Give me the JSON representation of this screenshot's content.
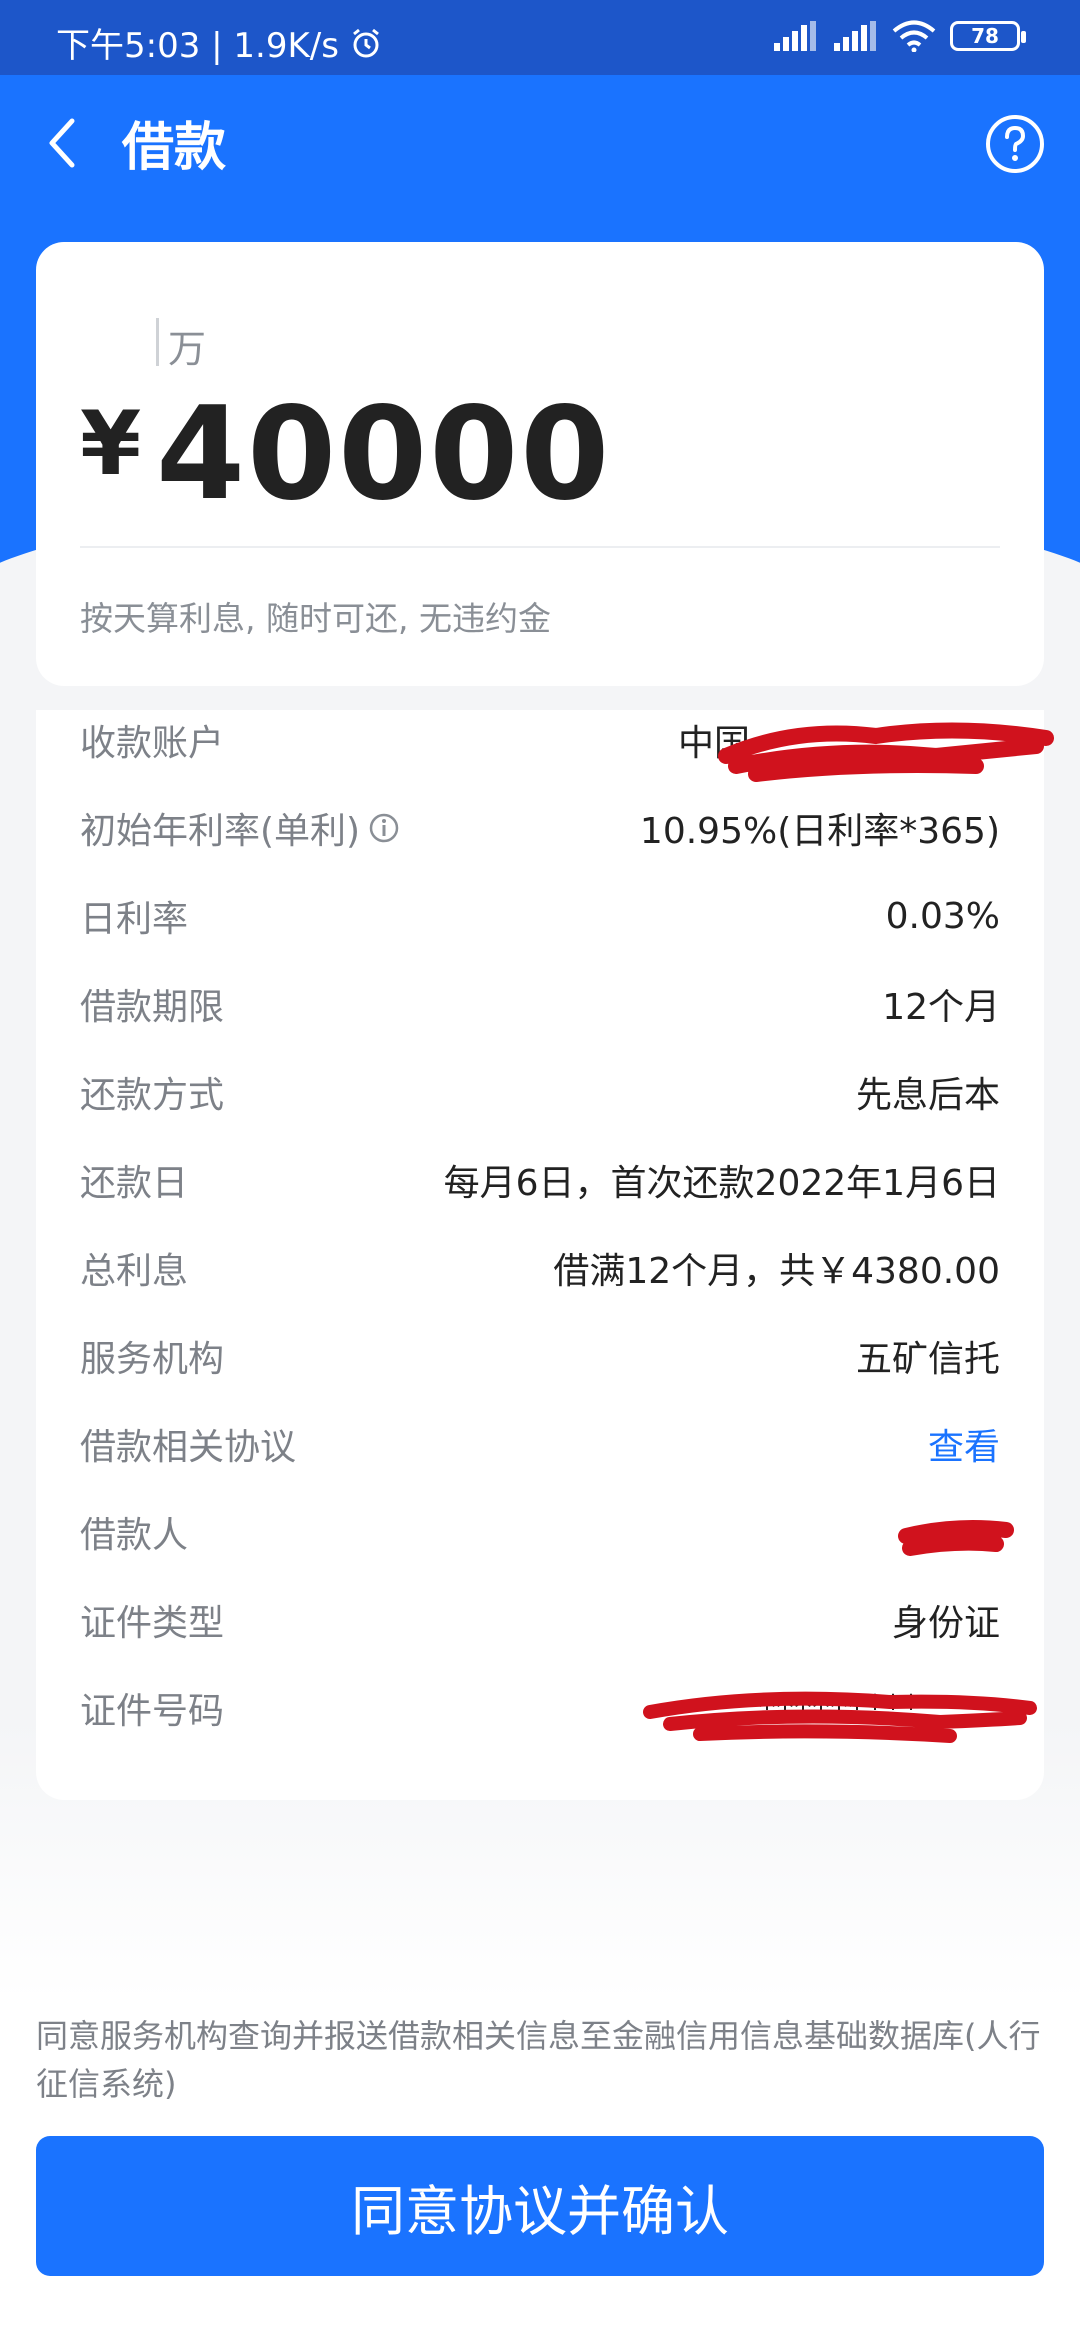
{
  "status_bar": {
    "time_speed": "下午5:03 | 1.9K/s",
    "battery": "78"
  },
  "header": {
    "title": "借款"
  },
  "amount": {
    "unit_hint": "万",
    "currency": "¥",
    "value": "40000",
    "note": "按天算利息, 随时可还, 无违约金"
  },
  "details": [
    {
      "label": "收款账户",
      "value": "中国"
    },
    {
      "label": "初始年利率(单利)",
      "value": "10.95%(日利率*365)"
    },
    {
      "label": "日利率",
      "value": "0.03%"
    },
    {
      "label": "借款期限",
      "value": "12个月"
    },
    {
      "label": "还款方式",
      "value": "先息后本"
    },
    {
      "label": "还款日",
      "value": "每月6日，首次还款2022年1月6日"
    },
    {
      "label": "总利息",
      "value": "借满12个月，共￥4380.00"
    },
    {
      "label": "服务机构",
      "value": "五矿信托"
    },
    {
      "label": "借款相关协议",
      "value": "查看"
    },
    {
      "label": "借款人",
      "value": ""
    },
    {
      "label": "证件类型",
      "value": "身份证"
    },
    {
      "label": "证件号码",
      "value": "*********"
    }
  ],
  "consent_text": "同意服务机构查询并报送借款相关信息至金融信用信息基础数据库(人行征信系统)",
  "confirm_label": "同意协议并确认",
  "colors": {
    "primary": "#1a73ff",
    "status_bar": "#1d56c9",
    "redaction": "#d0121d"
  }
}
